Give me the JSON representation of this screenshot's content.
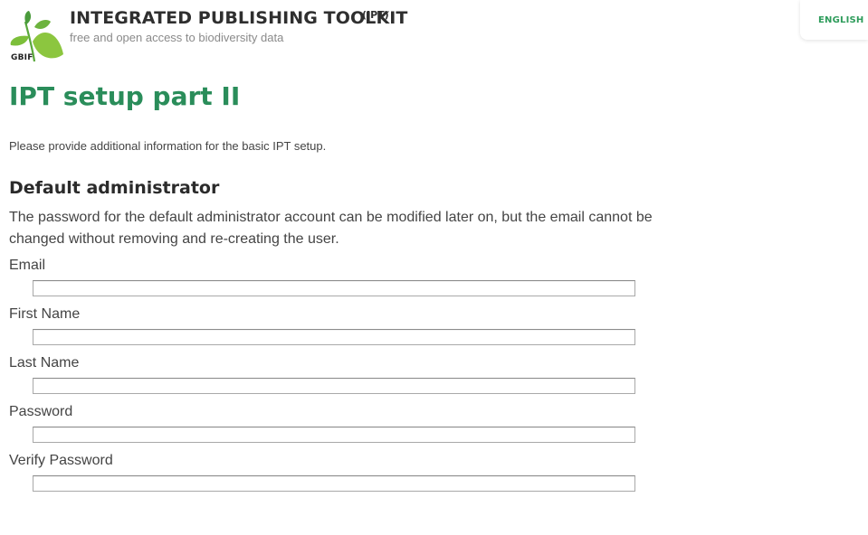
{
  "header": {
    "logo_text": "GBIF",
    "brand_title": "INTEGRATED PUBLISHING TOOLKIT",
    "brand_sup": "(IPT)",
    "tagline": "free and open access to biodiversity data",
    "language": "ENGLISH"
  },
  "page": {
    "title": "IPT setup part II",
    "intro": "Please provide additional information for the basic IPT setup."
  },
  "section": {
    "title": "Default administrator",
    "description": "The password for the default administrator account can be modified later on, but the email cannot be changed without removing and re-creating the user."
  },
  "form": {
    "fields": [
      {
        "label": "Email",
        "value": ""
      },
      {
        "label": "First Name",
        "value": ""
      },
      {
        "label": "Last Name",
        "value": ""
      },
      {
        "label": "Password",
        "value": ""
      },
      {
        "label": "Verify Password",
        "value": ""
      }
    ]
  },
  "colors": {
    "accent_green": "#2a8d5a",
    "logo_light_green": "#8cc63f",
    "logo_dark_green": "#4a9b3c"
  }
}
